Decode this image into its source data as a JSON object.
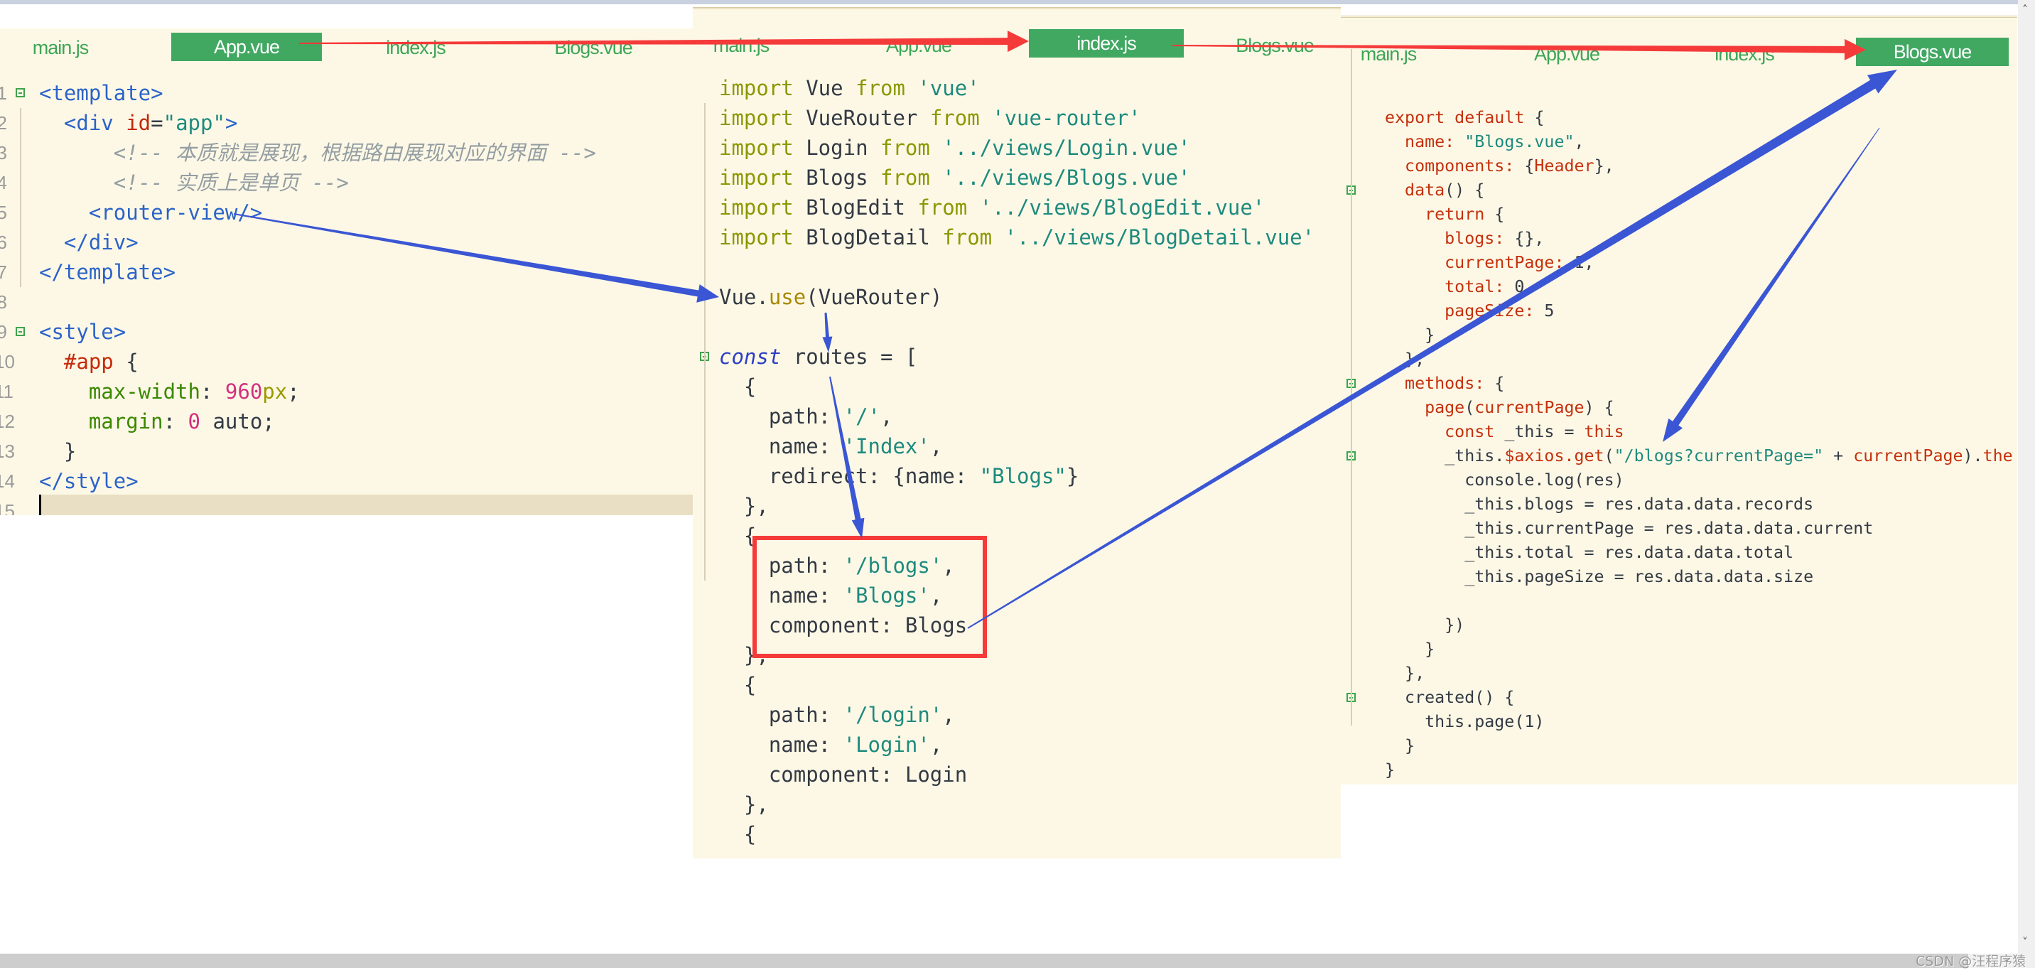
{
  "panels": [
    {
      "file": "App.vue",
      "tabs": [
        "main.js",
        "App.vue",
        "index.js",
        "Blogs.vue"
      ],
      "active_tab": "App.vue",
      "line_numbers": [
        "1",
        "2",
        "3",
        "4",
        "5",
        "6",
        "7",
        "8",
        "9",
        "10",
        "11",
        "12",
        "13",
        "14",
        "15"
      ],
      "lines": [
        [
          [
            "<template>",
            "tag"
          ]
        ],
        [
          [
            "  <div ",
            "tag"
          ],
          [
            "id",
            "attr"
          ],
          [
            "=",
            "id"
          ],
          [
            "\"app\"",
            "str"
          ],
          [
            ">",
            "tag"
          ]
        ],
        [
          [
            "      <!-- 本质就是展现，根据路由展现对应的界面 -->",
            "cmt"
          ]
        ],
        [
          [
            "      <!-- 实质上是单页 -->",
            "cmt"
          ]
        ],
        [
          [
            "    <router-view/>",
            "tag"
          ]
        ],
        [
          [
            "  </div>",
            "tag"
          ]
        ],
        [
          [
            "</template>",
            "tag"
          ]
        ],
        [
          [
            "",
            ""
          ]
        ],
        [
          [
            "<style>",
            "tag"
          ]
        ],
        [
          [
            "  ",
            ""
          ],
          [
            "#app",
            "sel"
          ],
          [
            " {",
            "id"
          ]
        ],
        [
          [
            "    ",
            ""
          ],
          [
            "max-width",
            "prop"
          ],
          [
            ": ",
            "id"
          ],
          [
            "960",
            "num"
          ],
          [
            "px",
            "unit"
          ],
          [
            ";",
            "id"
          ]
        ],
        [
          [
            "    ",
            ""
          ],
          [
            "margin",
            "prop"
          ],
          [
            ": ",
            "id"
          ],
          [
            "0",
            "num"
          ],
          [
            " auto;",
            "id"
          ]
        ],
        [
          [
            "  }",
            "id"
          ]
        ],
        [
          [
            "</style>",
            "tag"
          ]
        ],
        [
          [
            "",
            ""
          ]
        ]
      ]
    },
    {
      "file": "index.js",
      "tabs": [
        "main.js",
        "App.vue",
        "index.js",
        "Blogs.vue"
      ],
      "active_tab": "index.js",
      "lines": [
        [
          [
            "import",
            "kw"
          ],
          [
            " Vue ",
            "id"
          ],
          [
            "from",
            "kw"
          ],
          [
            " 'vue'",
            "str"
          ]
        ],
        [
          [
            "import",
            "kw"
          ],
          [
            " VueRouter ",
            "id"
          ],
          [
            "from",
            "kw"
          ],
          [
            " 'vue-router'",
            "str"
          ]
        ],
        [
          [
            "import",
            "kw"
          ],
          [
            " Login ",
            "id"
          ],
          [
            "from",
            "kw"
          ],
          [
            " '../views/Login.vue'",
            "str"
          ]
        ],
        [
          [
            "import",
            "kw"
          ],
          [
            " Blogs ",
            "id"
          ],
          [
            "from",
            "kw"
          ],
          [
            " '../views/Blogs.vue'",
            "str"
          ]
        ],
        [
          [
            "import",
            "kw"
          ],
          [
            " BlogEdit ",
            "id"
          ],
          [
            "from",
            "kw"
          ],
          [
            " '../views/BlogEdit.vue'",
            "str"
          ]
        ],
        [
          [
            "import",
            "kw"
          ],
          [
            " BlogDetail ",
            "id"
          ],
          [
            "from",
            "kw"
          ],
          [
            " '../views/BlogDetail.vue'",
            "str"
          ]
        ],
        [
          [
            "",
            ""
          ]
        ],
        [
          [
            "Vue.",
            "id"
          ],
          [
            "use",
            "use"
          ],
          [
            "(VueRouter)",
            "id"
          ]
        ],
        [
          [
            "",
            ""
          ]
        ],
        [
          [
            "const",
            "ckw"
          ],
          [
            " routes = [",
            "id"
          ]
        ],
        [
          [
            "  {",
            "id"
          ]
        ],
        [
          [
            "    path: ",
            "id"
          ],
          [
            "'/'",
            "str"
          ],
          [
            ",",
            "id"
          ]
        ],
        [
          [
            "    name: ",
            "id"
          ],
          [
            "'Index'",
            "str"
          ],
          [
            ",",
            "id"
          ]
        ],
        [
          [
            "    redirect: {name: ",
            "id"
          ],
          [
            "\"Blogs\"",
            "str"
          ],
          [
            "}",
            "id"
          ]
        ],
        [
          [
            "  },",
            "id"
          ]
        ],
        [
          [
            "  {",
            "id"
          ]
        ],
        [
          [
            "    path: ",
            "id"
          ],
          [
            "'/blogs'",
            "str"
          ],
          [
            ",",
            "id"
          ]
        ],
        [
          [
            "    name: ",
            "id"
          ],
          [
            "'Blogs'",
            "str"
          ],
          [
            ",",
            "id"
          ]
        ],
        [
          [
            "    component: Blogs",
            "id"
          ]
        ],
        [
          [
            "  },",
            "id"
          ]
        ],
        [
          [
            "  {",
            "id"
          ]
        ],
        [
          [
            "    path: ",
            "id"
          ],
          [
            "'/login'",
            "str"
          ],
          [
            ",",
            "id"
          ]
        ],
        [
          [
            "    name: ",
            "id"
          ],
          [
            "'Login'",
            "str"
          ],
          [
            ",",
            "id"
          ]
        ],
        [
          [
            "    component: Login",
            "id"
          ]
        ],
        [
          [
            "  },",
            "id"
          ]
        ],
        [
          [
            "  {",
            "id"
          ]
        ]
      ]
    },
    {
      "file": "Blogs.vue",
      "tabs": [
        "main.js",
        "App.vue",
        "index.js",
        "Blogs.vue"
      ],
      "active_tab": "Blogs.vue",
      "lines": [
        [
          [
            "export default",
            "red"
          ],
          [
            " {",
            "id"
          ]
        ],
        [
          [
            "  name: ",
            "red"
          ],
          [
            "\"Blogs.vue\"",
            "str"
          ],
          [
            ",",
            "id"
          ]
        ],
        [
          [
            "  components: ",
            "red"
          ],
          [
            "{",
            "id"
          ],
          [
            "Header",
            "red"
          ],
          [
            "},",
            "id"
          ]
        ],
        [
          [
            "  data",
            "red"
          ],
          [
            "() {",
            "id"
          ]
        ],
        [
          [
            "    return",
            "red"
          ],
          [
            " {",
            "id"
          ]
        ],
        [
          [
            "      blogs: ",
            "red"
          ],
          [
            "{},",
            "id"
          ]
        ],
        [
          [
            "      currentPage: ",
            "red"
          ],
          [
            "1,",
            "id"
          ]
        ],
        [
          [
            "      total: ",
            "red"
          ],
          [
            "0,",
            "id"
          ]
        ],
        [
          [
            "      pageSize: ",
            "red"
          ],
          [
            "5",
            "id"
          ]
        ],
        [
          [
            "    }",
            "id"
          ]
        ],
        [
          [
            "  },",
            "id"
          ]
        ],
        [
          [
            "  methods: ",
            "red"
          ],
          [
            "{",
            "id"
          ]
        ],
        [
          [
            "    page",
            "red"
          ],
          [
            "(",
            "id"
          ],
          [
            "currentPage",
            "red"
          ],
          [
            ") {",
            "id"
          ]
        ],
        [
          [
            "      const",
            "red"
          ],
          [
            " _this = ",
            "id"
          ],
          [
            "this",
            "red"
          ]
        ],
        [
          [
            "      _this.",
            "id"
          ],
          [
            "$axios.get",
            "red"
          ],
          [
            "(",
            "id"
          ],
          [
            "\"/blogs?currentPage=\"",
            "str"
          ],
          [
            " + ",
            "id"
          ],
          [
            "currentPage",
            "red"
          ],
          [
            ").",
            "id"
          ],
          [
            "the",
            "red"
          ]
        ],
        [
          [
            "        console.log(res)",
            "id"
          ]
        ],
        [
          [
            "        _this.blogs = res.data.data.records",
            "id"
          ]
        ],
        [
          [
            "        _this.currentPage = res.data.data.current",
            "id"
          ]
        ],
        [
          [
            "        _this.total = res.data.data.total",
            "id"
          ]
        ],
        [
          [
            "        _this.pageSize = res.data.data.size",
            "id"
          ]
        ],
        [
          [
            "",
            ""
          ]
        ],
        [
          [
            "      })",
            "id"
          ]
        ],
        [
          [
            "    }",
            "id"
          ]
        ],
        [
          [
            "  },",
            "id"
          ]
        ],
        [
          [
            "  created() {",
            "id"
          ]
        ],
        [
          [
            "    this.page(1)",
            "id"
          ]
        ],
        [
          [
            "  }",
            "id"
          ]
        ],
        [
          [
            "}",
            "id"
          ]
        ]
      ]
    }
  ],
  "watermark": "CSDN @汪程序猿",
  "icons": {
    "fold": "minus-square-icon",
    "scroll_up": "chevron-up-icon",
    "scroll_down": "chevron-down-icon",
    "scroll_right": "chevron-right-icon"
  },
  "colors": {
    "active_tab": "#41a862",
    "tab_text": "#3ea556",
    "editor_bg": "#fdf8e6",
    "annotation_red": "#f53a3a",
    "annotation_blue": "#3a56d4"
  }
}
